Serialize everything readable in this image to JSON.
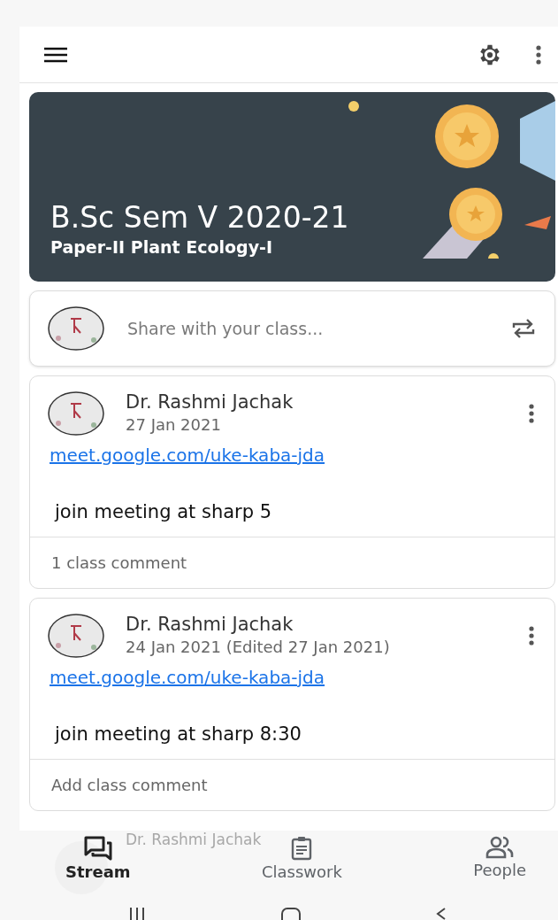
{
  "banner": {
    "title": "B.Sc Sem V 2020-21",
    "subtitle": "Paper-II Plant Ecology-I"
  },
  "share": {
    "placeholder": "Share with your class..."
  },
  "posts": [
    {
      "author": "Dr. Rashmi Jachak",
      "date": "27 Jan 2021",
      "link": "meet.google.com/uke-kaba-jda",
      "body": "join meeting at sharp 5",
      "footer": "1 class comment"
    },
    {
      "author": "Dr. Rashmi Jachak",
      "date": "24 Jan 2021 (Edited 27 Jan 2021)",
      "link": "meet.google.com/uke-kaba-jda",
      "body": "join meeting at sharp 8:30",
      "footer": "Add class comment"
    }
  ],
  "peek_post": {
    "author": "Dr. Rashmi Jachak"
  },
  "nav_tabs": [
    {
      "kind": "stream",
      "label": "Stream",
      "selected": true
    },
    {
      "kind": "classwork",
      "label": "Classwork",
      "selected": false
    },
    {
      "kind": "people",
      "label": "People",
      "selected": false
    }
  ]
}
